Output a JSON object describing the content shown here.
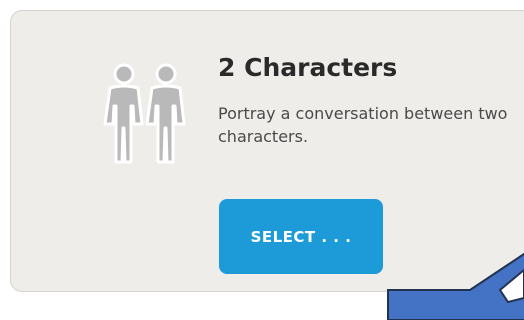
{
  "card": {
    "icon": "two-characters-icon",
    "title": "2 Characters",
    "description": "Portray a conversation between two characters.",
    "select_label": "SELECT . . ."
  },
  "colors": {
    "card_background": "#efedea",
    "button": "#1d9bd9",
    "arrow_fill": "#4472c4",
    "arrow_stroke": "#22334f"
  },
  "overlay": {
    "icon": "callout-arrow"
  }
}
